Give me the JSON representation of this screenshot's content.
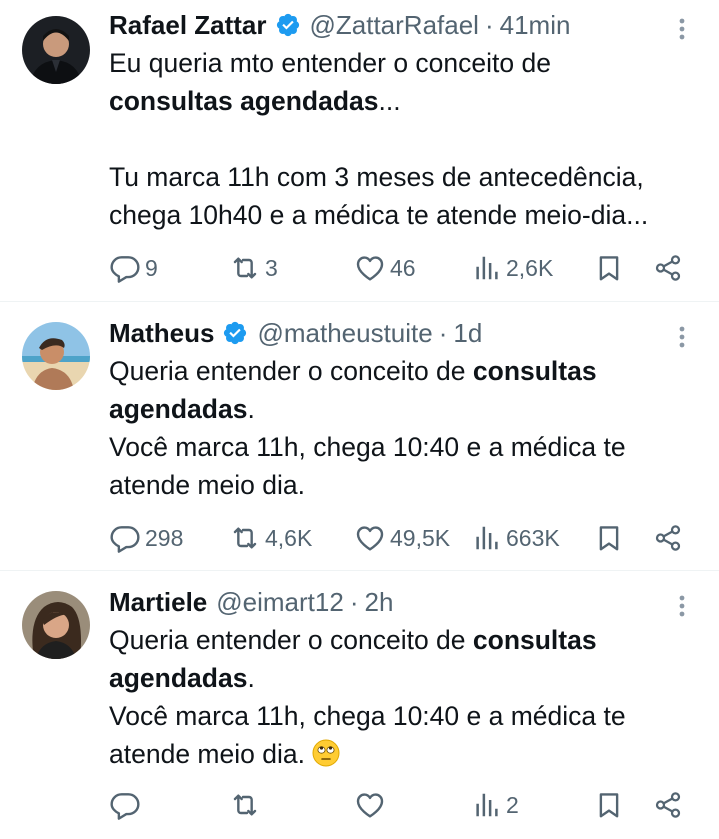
{
  "tweets": [
    {
      "name": "Rafael Zattar",
      "handle": "@ZattarRafael",
      "time": "41min",
      "line1": "Eu queria mto entender o conceito de",
      "line2_bold": "consultas agendadas",
      "line2_rest": "...",
      "line3": "Tu marca 11h com 3 meses de antecedência,",
      "line4": "chega 10h40 e a médica te atende meio-dia...",
      "replies": "9",
      "retweets": "3",
      "likes": "46",
      "views": "2,6K"
    },
    {
      "name": "Matheus",
      "handle": "@matheustuite",
      "time": "1d",
      "line1_pre": "Queria entender o conceito de ",
      "line1_bold": "consultas",
      "line2_bold": "agendadas",
      "line2_rest": ".",
      "line3": "Você marca 11h, chega 10:40 e a médica te",
      "line4": "atende meio dia.",
      "replies": "298",
      "retweets": "4,6K",
      "likes": "49,5K",
      "views": "663K"
    },
    {
      "name": "Martiele",
      "handle": "@eimart12",
      "time": "2h",
      "line1_pre": "Queria entender o conceito de ",
      "line1_bold": "consultas",
      "line2_bold": "agendadas",
      "line2_rest": ".",
      "line3": "Você marca 11h, chega 10:40 e a médica te",
      "line4": "atende meio dia.",
      "emoji": "eye-roll-emoji",
      "replies": "",
      "retweets": "",
      "likes": "",
      "views": "2"
    }
  ],
  "separator": "·",
  "icons": {
    "verified": "verified-badge-icon",
    "more": "more-vertical-icon",
    "reply": "reply-icon",
    "retweet": "retweet-icon",
    "like": "heart-icon",
    "views": "views-icon",
    "bookmark": "bookmark-icon",
    "share": "share-icon"
  },
  "colors": {
    "text": "#0f1419",
    "secondary": "#536471",
    "verified": "#1d9bf0",
    "divider": "#eff3f4"
  }
}
